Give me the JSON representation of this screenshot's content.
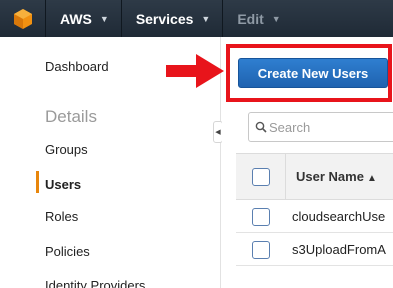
{
  "topbar": {
    "brand": "AWS",
    "services": "Services",
    "edit": "Edit"
  },
  "sidebar": {
    "dashboard": "Dashboard",
    "details_heading": "Details",
    "items": [
      {
        "label": "Groups"
      },
      {
        "label": "Users"
      },
      {
        "label": "Roles"
      },
      {
        "label": "Policies"
      },
      {
        "label": "Identity Providers"
      }
    ],
    "active_item": "Users"
  },
  "main": {
    "create_button": "Create New Users",
    "search_placeholder": "Search",
    "table": {
      "column_user_name": "User Name",
      "rows": [
        {
          "user_name": "cloudsearchUse"
        },
        {
          "user_name": "s3UploadFromA"
        }
      ]
    }
  },
  "colors": {
    "topbar": "#232f3e",
    "primary_button": "#1f63b0",
    "highlight": "#e8141b",
    "active_accent": "#e8860c"
  }
}
